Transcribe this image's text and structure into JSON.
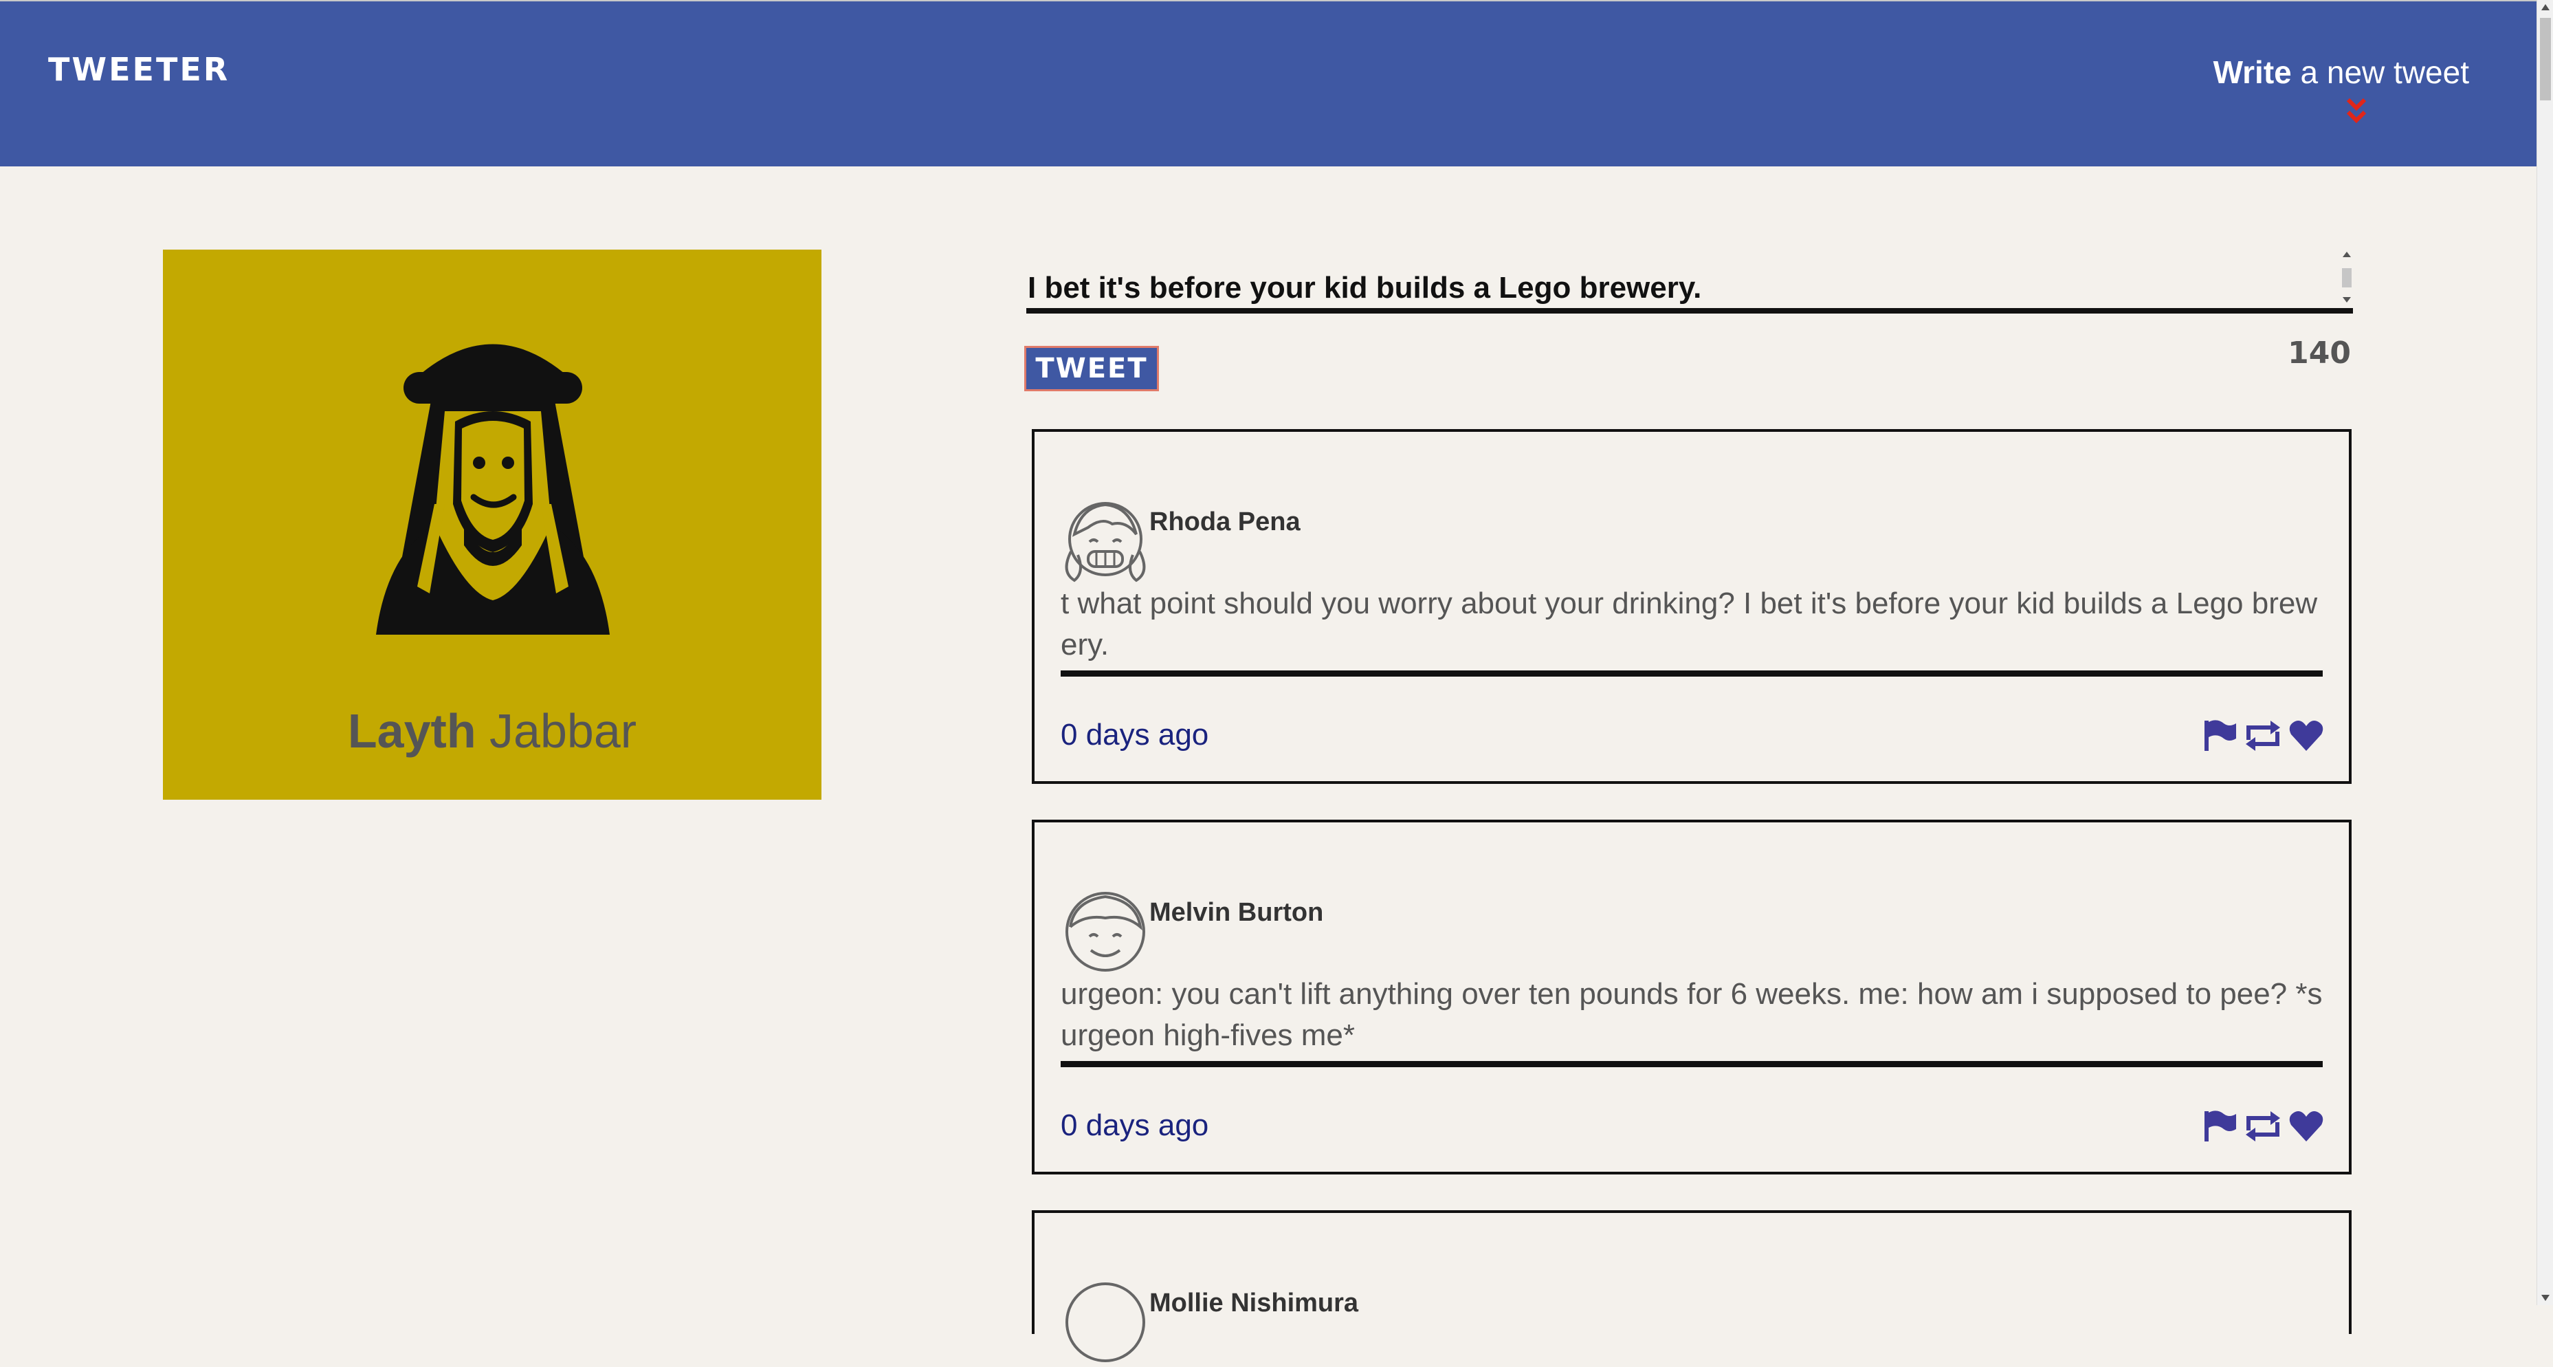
{
  "nav": {
    "brand": "TWEETER",
    "compose_bold": "Write",
    "compose_rest": " a new tweet"
  },
  "profile": {
    "first_name": "Layth",
    "last_name": "Jabbar",
    "avatar_icon": "person-with-headdress-icon",
    "background_color": "#c3a901"
  },
  "composer": {
    "text": "I bet it's before your kid builds a Lego brewery.",
    "button_label": "TWEET",
    "counter": "140"
  },
  "tweets": [
    {
      "author": "Rhoda Pena",
      "text": "t what point should you worry about your drinking? I bet it's before your kid builds a Lego brewery.",
      "time": "0 days ago"
    },
    {
      "author": "Melvin Burton",
      "text": "urgeon: you can't lift anything over ten pounds for 6 weeks. me: how am i supposed to pee? *surgeon high-fives me*",
      "time": "0 days ago"
    },
    {
      "author": "Mollie Nishimura",
      "text": "",
      "time": ""
    }
  ],
  "colors": {
    "nav": "#3f58a3",
    "accent": "#3f3a9a",
    "chevron": "#e0261a",
    "time": "#1a237e"
  }
}
